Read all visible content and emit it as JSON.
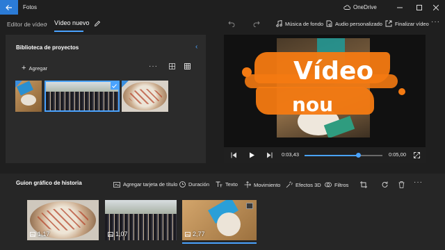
{
  "titlebar": {
    "app_name": "Fotos",
    "onedrive_label": "OneDrive"
  },
  "breadcrumb": {
    "parent": "Editor de vídeo",
    "current": "Vídeo nuevo"
  },
  "toolbar": {
    "music_label": "Música de fondo",
    "custom_audio_label": "Audio personalizado",
    "finish_label": "Finalizar vídeo"
  },
  "library": {
    "title": "Biblioteca de proyectos",
    "add_label": "Agregar"
  },
  "preview": {
    "overlay_line1": "Vídeo",
    "overlay_line2": "nou",
    "current_time": "0:03,43",
    "total_time": "0:05,00",
    "progress_fraction": 0.69
  },
  "storyboard": {
    "title": "Guion gráfico de historia",
    "tools": {
      "title_card": "Agregar tarjeta de título",
      "duration": "Duración",
      "text": "Texto",
      "motion": "Movimiento",
      "effects_3d": "Efectos 3D",
      "filters": "Filtros"
    },
    "clips": [
      {
        "duration": "1,17"
      },
      {
        "duration": "1,07"
      },
      {
        "duration": "2,77"
      }
    ]
  },
  "colors": {
    "accent": "#4aa3ff",
    "back_button": "#2b7bd6",
    "overlay_orange": "#f47a12"
  }
}
